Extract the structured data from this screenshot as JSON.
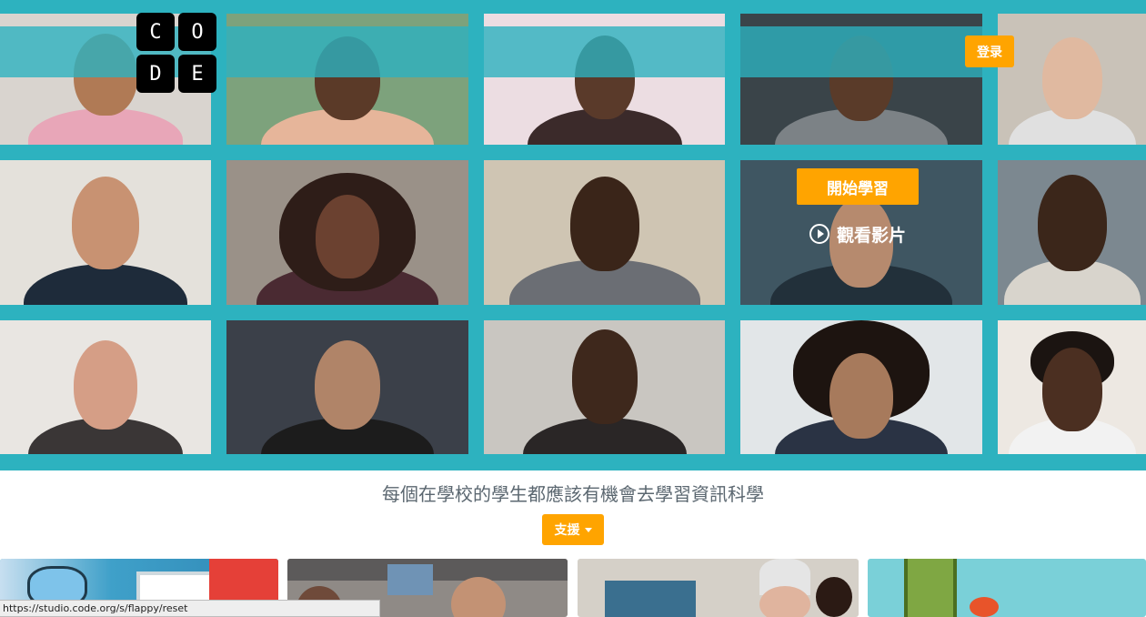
{
  "header": {
    "logo_letters": [
      "C",
      "O",
      "D",
      "E"
    ],
    "login_label": "登录"
  },
  "hero": {
    "start_label": "開始學習",
    "watch_label": "觀看影片",
    "play_icon": "play-circle-icon"
  },
  "tagline": "每個在學校的學生都應該有機會去學習資訊科學",
  "support": {
    "label": "支援",
    "caret_icon": "caret-down-icon"
  },
  "status_url": "https://studio.code.org/s/flappy/reset",
  "colors": {
    "accent": "#ffa400",
    "teal": "#2db2bf",
    "text": "#5b6770"
  }
}
